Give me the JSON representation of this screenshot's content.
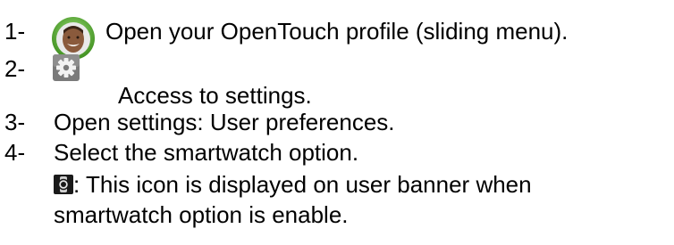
{
  "steps": [
    {
      "number": "1-",
      "text": "Open your OpenTouch profile (sliding menu).",
      "icon": "user-avatar-icon"
    },
    {
      "number": "2-",
      "text": "Access to settings.",
      "icon": "settings-gear-icon"
    },
    {
      "number": "3-",
      "text": "Open settings: User preferences."
    },
    {
      "number": "4-",
      "text": "Select the smartwatch option."
    }
  ],
  "note": {
    "icon": "smartwatch-icon",
    "line1": ": This icon is displayed on user banner when",
    "line2": "smartwatch option is enable."
  },
  "colors": {
    "avatar_ring": "#5fb034",
    "gear_bg": "#7a7a7a",
    "watch_bg": "#1a1a1a"
  }
}
